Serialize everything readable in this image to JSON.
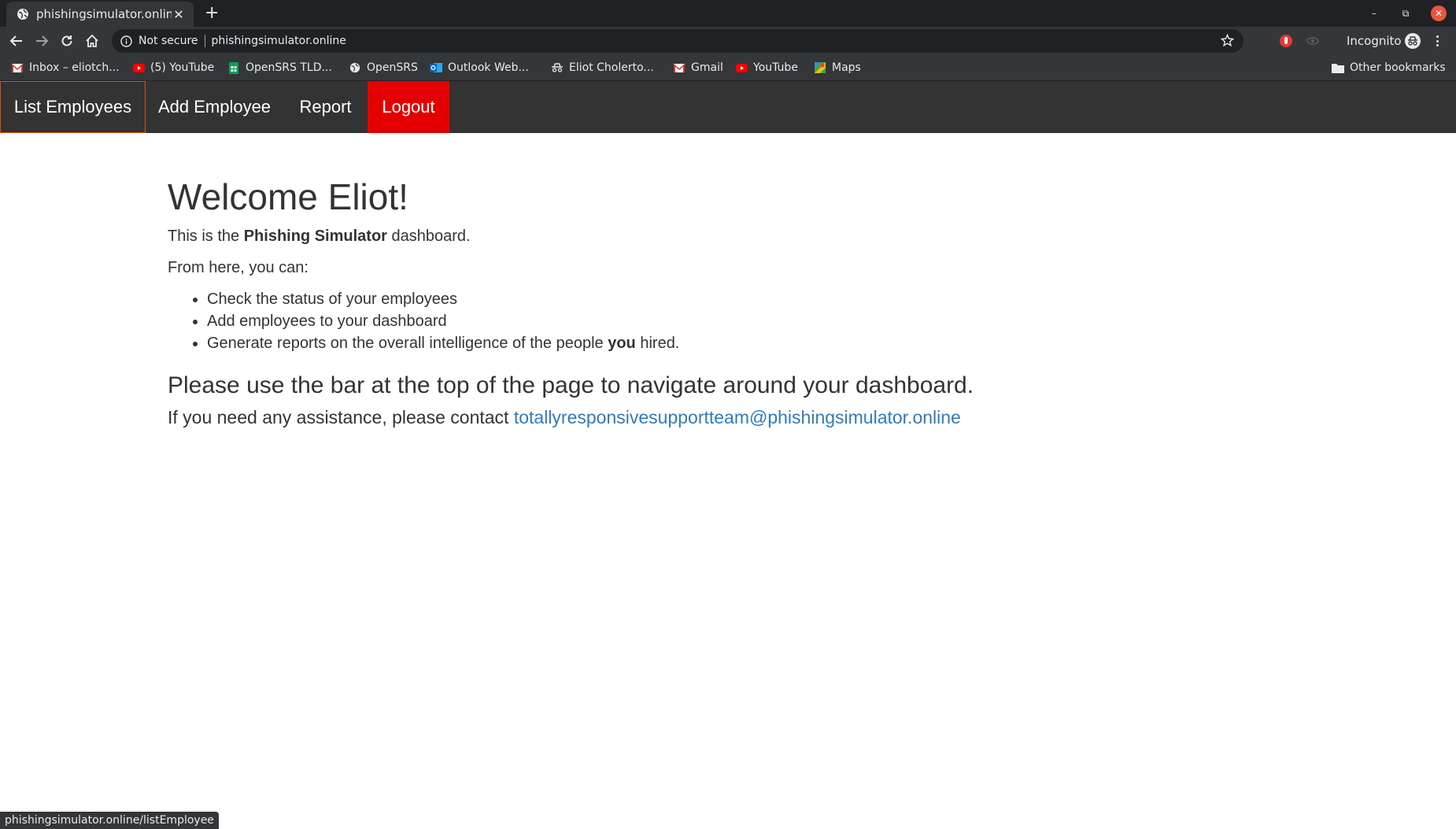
{
  "browser": {
    "tab": {
      "title": "phishingsimulator.online",
      "close_glyph": "✕",
      "favicon": "globe-icon"
    },
    "new_tab_glyph": "+",
    "window": {
      "minimize": "–",
      "restore": "⧉",
      "close": "✕"
    },
    "omnibox": {
      "security_label": "Not secure",
      "url": "phishingsimulator.online"
    },
    "profile_label": "Incognito",
    "bookmarks": [
      {
        "label": "Inbox – eliotch...",
        "icon": "gmail-icon"
      },
      {
        "label": "(5) YouTube",
        "icon": "youtube-icon"
      },
      {
        "label": "OpenSRS TLD...",
        "icon": "sheets-icon"
      },
      {
        "label": "OpenSRS",
        "icon": "globe-icon"
      },
      {
        "label": "Outlook Web...",
        "icon": "outlook-icon"
      },
      {
        "label": "Eliot Cholerto...",
        "icon": "incognito-icon"
      },
      {
        "label": "Gmail",
        "icon": "gmail-icon"
      },
      {
        "label": "YouTube",
        "icon": "youtube-icon"
      },
      {
        "label": "Maps",
        "icon": "maps-icon"
      }
    ],
    "other_bookmarks": "Other bookmarks",
    "status_url": "phishingsimulator.online/listEmployee"
  },
  "nav": {
    "items": [
      {
        "label": "List Employees"
      },
      {
        "label": "Add Employee"
      },
      {
        "label": "Report"
      },
      {
        "label": "Logout"
      }
    ]
  },
  "main": {
    "heading": "Welcome Eliot!",
    "intro_prefix": "This is the ",
    "intro_bold": "Phishing Simulator",
    "intro_suffix": " dashboard.",
    "from_here": "From here, you can:",
    "bullets": [
      "Check the status of your employees",
      "Add employees to your dashboard"
    ],
    "bullet3_prefix": "Generate reports on the overall intelligence of the people ",
    "bullet3_bold": "you",
    "bullet3_suffix": " hired.",
    "subheading": "Please use the bar at the top of the page to navigate around your dashboard.",
    "assist_prefix": "If you need any assistance, please contact ",
    "assist_email": "totallyresponsivesupportteam@phishingsimulator.online"
  },
  "colors": {
    "navbar_bg": "#333333",
    "logout_bg": "#e50000",
    "active_border": "#d9530f",
    "link": "#337ab7",
    "text": "#333333"
  }
}
